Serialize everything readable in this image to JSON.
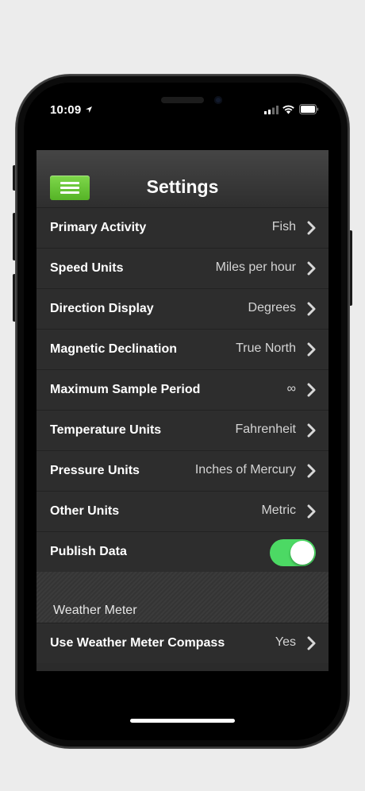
{
  "status_bar": {
    "time": "10:09"
  },
  "nav": {
    "title": "Settings",
    "menu_icon": "hamburger-menu-icon"
  },
  "settings": [
    {
      "label": "Primary Activity",
      "value": "Fish"
    },
    {
      "label": "Speed Units",
      "value": "Miles per hour"
    },
    {
      "label": "Direction Display",
      "value": "Degrees"
    },
    {
      "label": "Magnetic Declination",
      "value": "True North"
    },
    {
      "label": "Maximum Sample Period",
      "value": "∞"
    },
    {
      "label": "Temperature Units",
      "value": "Fahrenheit"
    },
    {
      "label": "Pressure Units",
      "value": "Inches of Mercury"
    },
    {
      "label": "Other Units",
      "value": "Metric"
    }
  ],
  "publish": {
    "label": "Publish Data",
    "enabled": true
  },
  "section": {
    "title": "Weather Meter",
    "rows": [
      {
        "label": "Use Weather Meter Compass",
        "value": "Yes"
      }
    ]
  },
  "colors": {
    "accent_green": "#5cbf2a",
    "toggle_on": "#4cd964",
    "background": "#2d2d2d"
  }
}
